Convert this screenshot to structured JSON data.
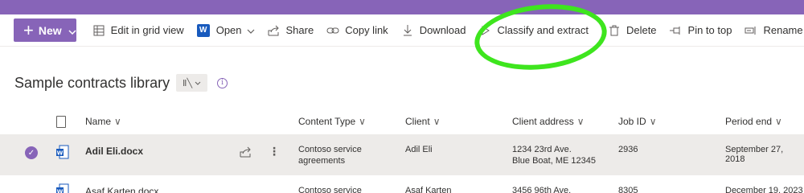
{
  "colors": {
    "brand": "#8764b8",
    "highlight": "#3ee51e",
    "word": "#185abd"
  },
  "toolbar": {
    "new_label": "New",
    "items": [
      {
        "label": "Edit in grid view",
        "icon": "grid-icon"
      },
      {
        "label": "Open",
        "icon": "word-icon"
      },
      {
        "label": "Share",
        "icon": "share-icon"
      },
      {
        "label": "Copy link",
        "icon": "link-icon"
      },
      {
        "label": "Download",
        "icon": "download-icon"
      },
      {
        "label": "Classify and extract",
        "icon": "play-icon"
      },
      {
        "label": "Delete",
        "icon": "trash-icon"
      },
      {
        "label": "Pin to top",
        "icon": "pin-icon"
      },
      {
        "label": "Rename",
        "icon": "rename-icon"
      }
    ]
  },
  "library": {
    "title": "Sample contracts library"
  },
  "table": {
    "headers": {
      "name": "Name",
      "content_type": "Content Type",
      "client": "Client",
      "client_address": "Client address",
      "job_id": "Job ID",
      "period_end": "Period end"
    },
    "rows": [
      {
        "name": "Adil Eli.docx",
        "content_type_1": "Contoso service",
        "content_type_2": "agreements",
        "client": "Adil Eli",
        "address_1": "1234 23rd Ave.",
        "address_2": "Blue Boat, ME 12345",
        "job_id": "2936",
        "period_end": "September 27, 2018",
        "selected": true
      },
      {
        "name": "Asaf Karten.docx",
        "content_type_1": "Contoso service",
        "client": "Asaf Karten",
        "address_1": "3456 96th Ave.",
        "job_id": "8305",
        "period_end": "December 19, 2023",
        "selected": false
      }
    ]
  }
}
